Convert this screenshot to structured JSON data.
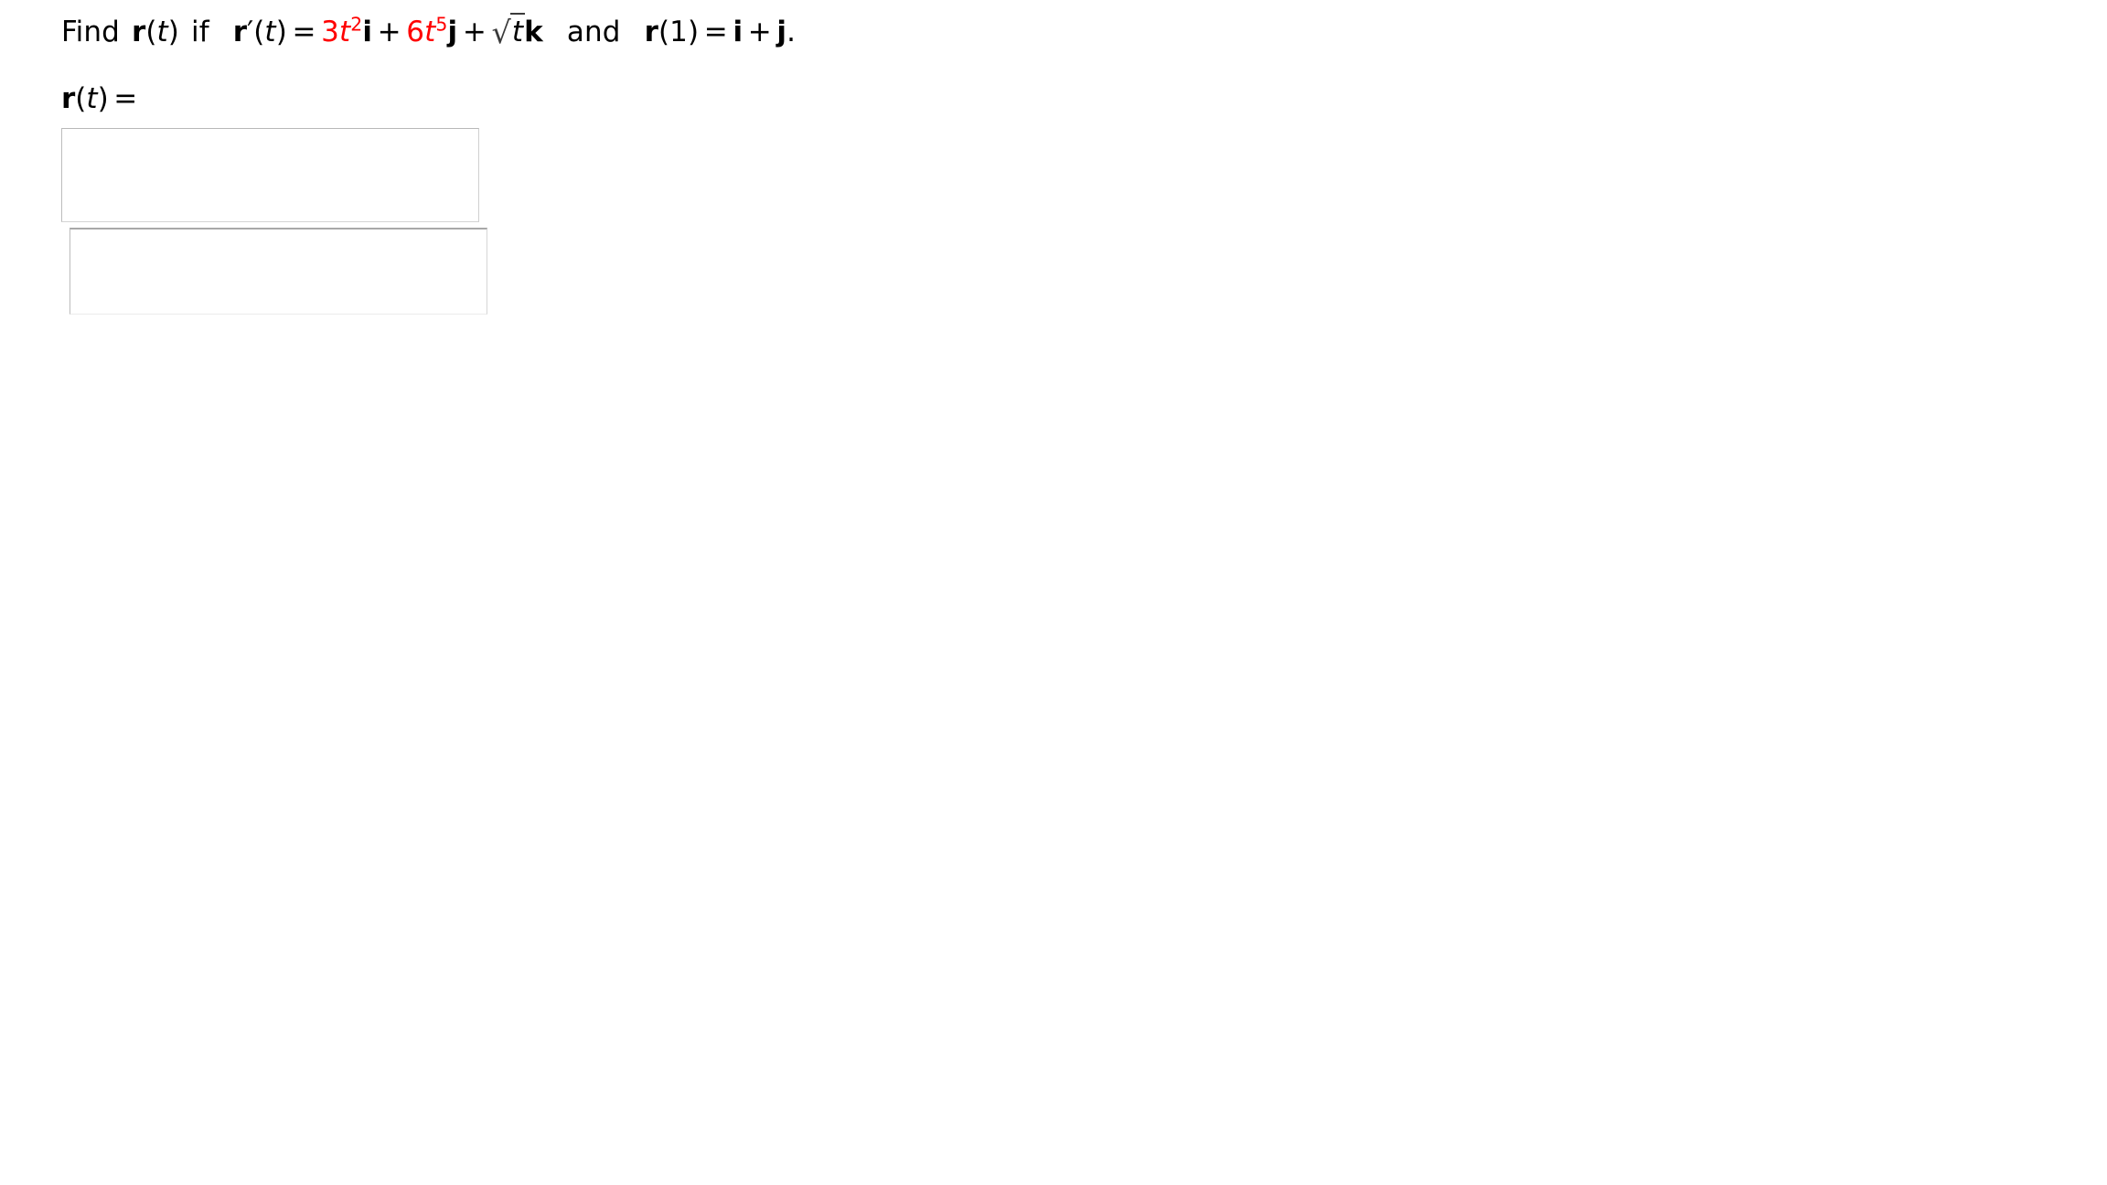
{
  "page": {
    "background_color": "#ffffff",
    "text_color": "#000000",
    "accent_color": "#ff0000",
    "radical_color": "#3a3a3a",
    "box_border_color": "#c6c6c6"
  },
  "problem": {
    "lead_text": "Find",
    "function_name": "r",
    "function_arg": "t",
    "conditional_word": "if",
    "derivative_name": "r",
    "derivative_prime": "′",
    "derivative_arg": "t",
    "equals": "=",
    "term1": {
      "coefficient": "3",
      "variable": "t",
      "exponent": "2",
      "unit_vector": "i",
      "color": "#ff0000"
    },
    "plus1": "+",
    "term2": {
      "coefficient": "6",
      "variable": "t",
      "exponent": "5",
      "unit_vector": "j",
      "color": "#ff0000"
    },
    "plus2": "+",
    "term3": {
      "radical_symbol": "√",
      "radicand": "t",
      "unit_vector": "k",
      "color": "#000000"
    },
    "conjunction": "and",
    "initial_condition": {
      "function_name": "r",
      "arg": "1",
      "equals": "=",
      "unit_vector_1": "i",
      "plus": "+",
      "unit_vector_2": "j",
      "period": "."
    },
    "full_text": "Find r(t) if r′(t) = 3t²i + 6t⁵j + √t k  and  r(1) = i + j."
  },
  "answer_prompt": {
    "function_name": "r",
    "arg": "t",
    "open_paren": "(",
    "close_paren": ")",
    "equals": "=",
    "full_text": "r(t) ="
  },
  "answer_fields": [
    {
      "id": "answer-box-1",
      "value": "",
      "placeholder": ""
    },
    {
      "id": "answer-box-2",
      "value": "",
      "placeholder": ""
    }
  ]
}
